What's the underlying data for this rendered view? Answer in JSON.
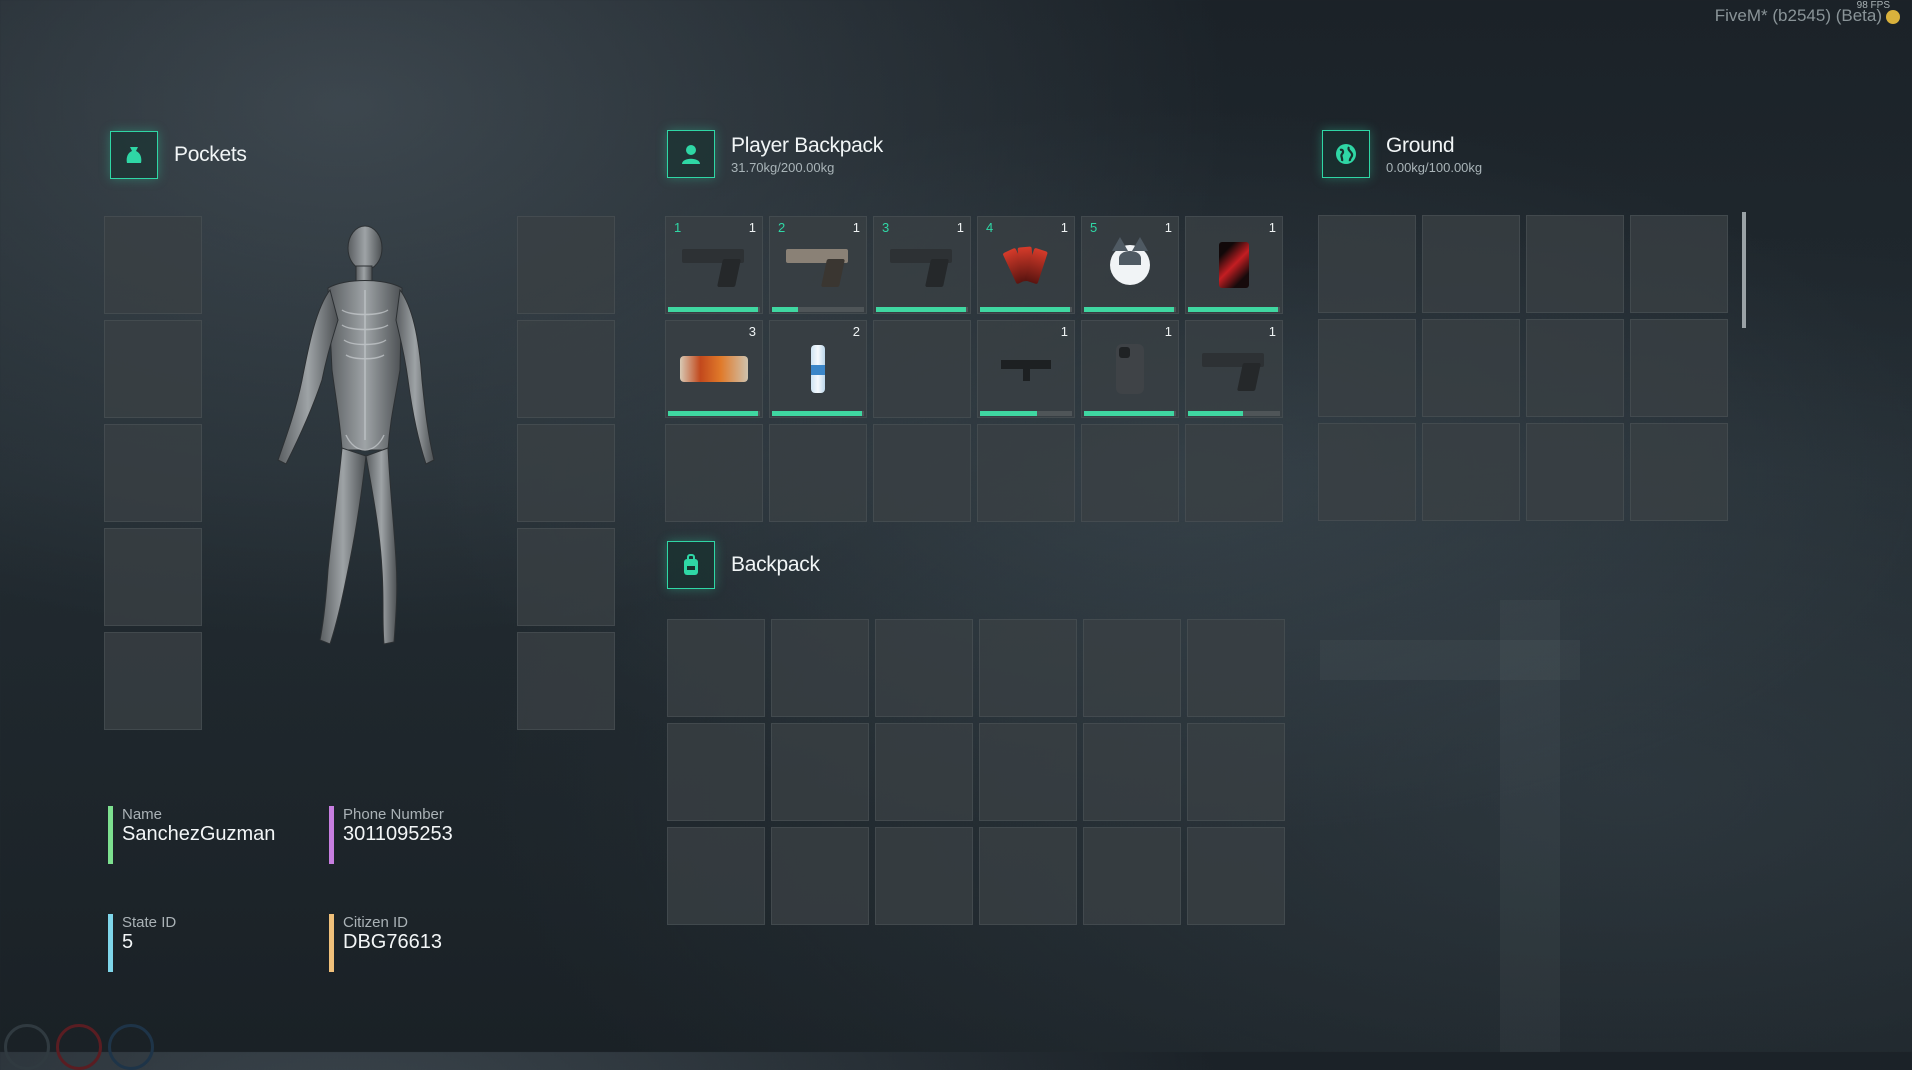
{
  "overlay": {
    "fps": "98 FPS",
    "client": "FiveM* (b2545) (Beta)"
  },
  "pockets": {
    "title": "Pockets",
    "icon": "bag-icon"
  },
  "player_backpack": {
    "title": "Player Backpack",
    "weight": "31.70kg/200.00kg",
    "icon": "person-icon",
    "slots": [
      {
        "slot": "1",
        "qty": "1",
        "item": "pistol-icon",
        "durability": 0.98
      },
      {
        "slot": "2",
        "qty": "1",
        "item": "pistol-icon",
        "durability": 0.28
      },
      {
        "slot": "3",
        "qty": "1",
        "item": "pistol-icon",
        "durability": 0.98
      },
      {
        "slot": "4",
        "qty": "1",
        "item": "cards-icon",
        "durability": 0.98
      },
      {
        "slot": "5",
        "qty": "1",
        "item": "husky-icon",
        "durability": 0.98
      },
      {
        "slot": "",
        "qty": "1",
        "item": "red-case-icon",
        "durability": 0.98
      },
      {
        "slot": "",
        "qty": "3",
        "item": "candy-bar-icon",
        "durability": 0.98
      },
      {
        "slot": "",
        "qty": "2",
        "item": "water-bottle-icon",
        "durability": 0.98
      },
      {
        "slot": "",
        "qty": "",
        "item": "",
        "durability": null
      },
      {
        "slot": "",
        "qty": "1",
        "item": "smg-icon",
        "durability": 0.62
      },
      {
        "slot": "",
        "qty": "1",
        "item": "phone-icon",
        "durability": 0.98
      },
      {
        "slot": "",
        "qty": "1",
        "item": "pistol-icon",
        "durability": 0.6
      }
    ]
  },
  "ground": {
    "title": "Ground",
    "weight": "0.00kg/100.00kg",
    "icon": "globe-icon"
  },
  "backpack": {
    "title": "Backpack",
    "icon": "backpack-icon"
  },
  "character": {
    "name_label": "Name",
    "name": "SanchezGuzman",
    "phone_label": "Phone Number",
    "phone": "3011095253",
    "state_label": "State ID",
    "state_id": "5",
    "citizen_label": "Citizen ID",
    "citizen_id": "DBG76613",
    "colors": {
      "name": "#7de08f",
      "phone": "#c77ee0",
      "state": "#7fd6ea",
      "citizen": "#f0c07a"
    }
  },
  "accent": "#2fd7a5"
}
